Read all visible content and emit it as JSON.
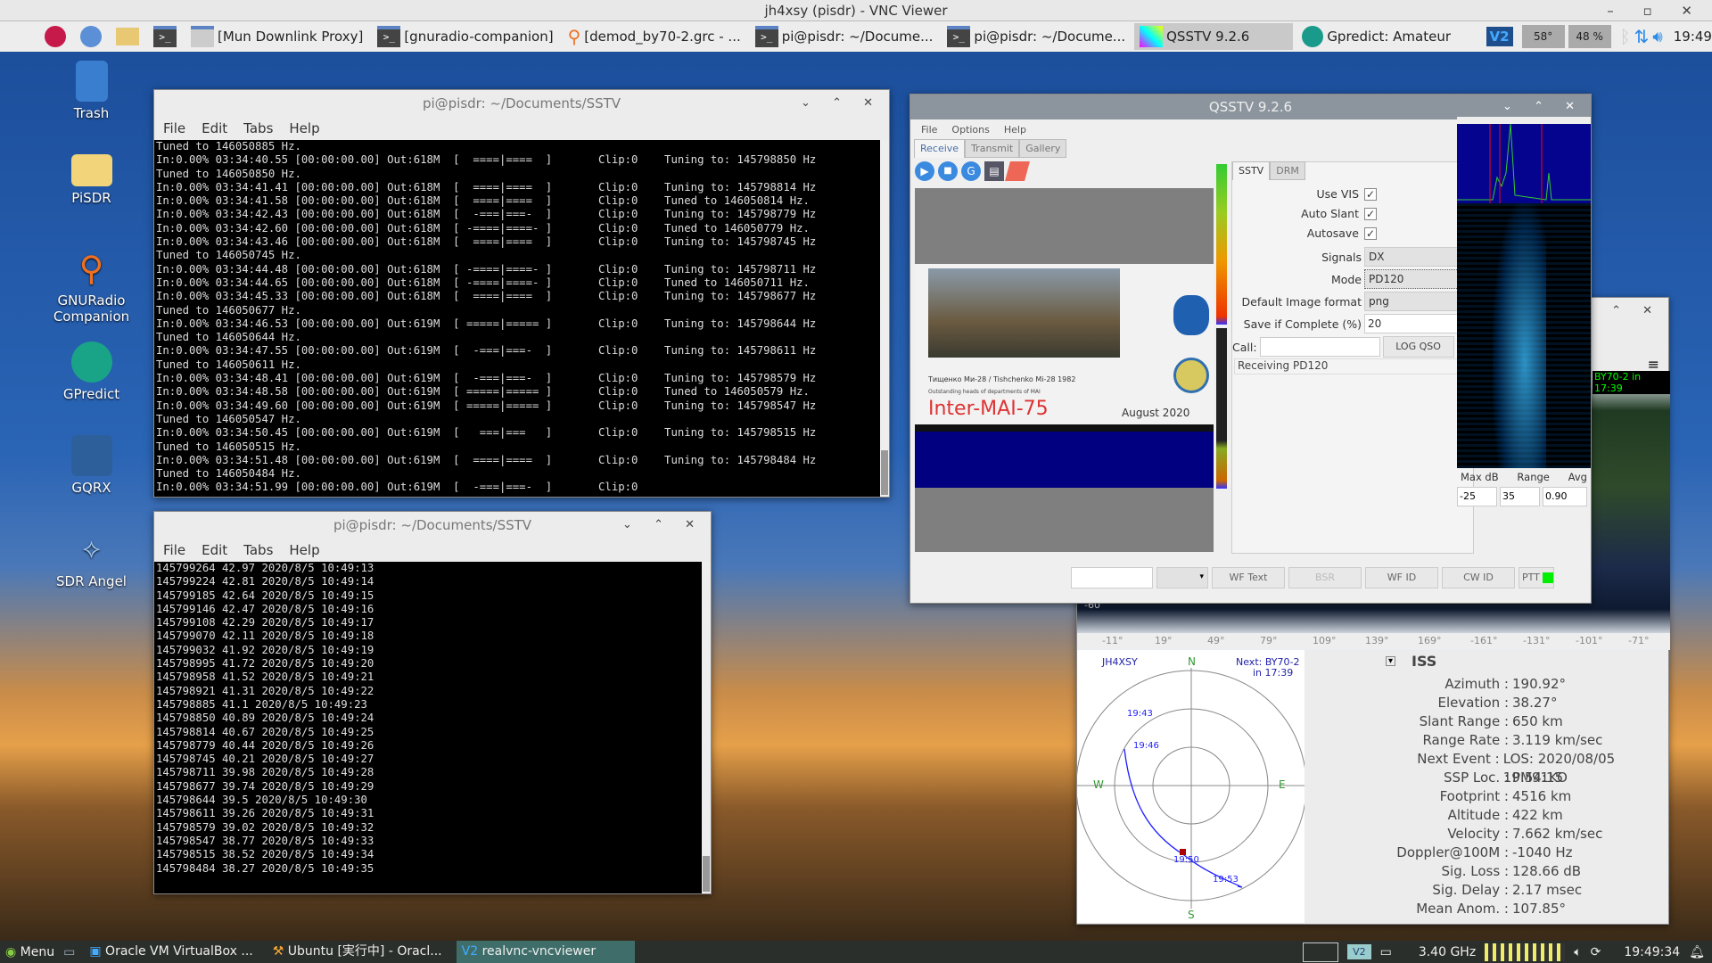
{
  "vnc": {
    "title": "jh4xsy (pisdr) - VNC Viewer",
    "controls": "– ▫ ✕"
  },
  "top_panel": {
    "items": [
      {
        "label": "",
        "icon": "raspberry-icon"
      },
      {
        "label": "",
        "icon": "globe-icon"
      },
      {
        "label": "",
        "icon": "folder-icon"
      },
      {
        "label": "",
        "icon": "terminal-icon"
      },
      {
        "label": "[Mun Downlink Proxy]",
        "icon": "window-icon"
      },
      {
        "label": "[gnuradio-companion]",
        "icon": "terminal-icon"
      },
      {
        "label": "[demod_by70-2.grc - ...",
        "icon": "gnuradio-icon"
      },
      {
        "label": "pi@pisdr: ~/Docume...",
        "icon": "terminal-icon"
      },
      {
        "label": "pi@pisdr: ~/Docume...",
        "icon": "terminal-icon"
      },
      {
        "label": "QSSTV 9.2.6",
        "icon": "qsstv-icon"
      },
      {
        "label": "Gpredict: Amateur",
        "icon": "gpredict-icon"
      }
    ],
    "cpu_temp": "58°",
    "cpu_usage": "48 %",
    "clock": "19:49"
  },
  "desktop_icons": [
    {
      "label": "Trash"
    },
    {
      "label": "PiSDR"
    },
    {
      "label": "GNURadio Companion"
    },
    {
      "label": "GPredict"
    },
    {
      "label": "GQRX"
    },
    {
      "label": "SDR Angel"
    }
  ],
  "terminal1": {
    "title": "pi@pisdr: ~/Documents/SSTV",
    "menu": [
      "File",
      "Edit",
      "Tabs",
      "Help"
    ],
    "lines": [
      "Tuned to 146050885 Hz.",
      "In:0.00% 03:34:40.55 [00:00:00.00] Out:618M  [  ====|====  ]       Clip:0    Tuning to: 145798850 Hz",
      "Tuned to 146050850 Hz.",
      "In:0.00% 03:34:41.41 [00:00:00.00] Out:618M  [  ====|====  ]       Clip:0    Tuning to: 145798814 Hz",
      "In:0.00% 03:34:41.58 [00:00:00.00] Out:618M  [  ====|====  ]       Clip:0    Tuned to 146050814 Hz.",
      "In:0.00% 03:34:42.43 [00:00:00.00] Out:618M  [  -===|===-  ]       Clip:0    Tuning to: 145798779 Hz",
      "In:0.00% 03:34:42.60 [00:00:00.00] Out:618M  [ -====|====- ]       Clip:0    Tuned to 146050779 Hz.",
      "In:0.00% 03:34:43.46 [00:00:00.00] Out:618M  [  ====|====  ]       Clip:0    Tuning to: 145798745 Hz",
      "Tuned to 146050745 Hz.",
      "In:0.00% 03:34:44.48 [00:00:00.00] Out:618M  [ -====|====- ]       Clip:0    Tuning to: 145798711 Hz",
      "In:0.00% 03:34:44.65 [00:00:00.00] Out:618M  [ -====|====- ]       Clip:0    Tuned to 146050711 Hz.",
      "In:0.00% 03:34:45.33 [00:00:00.00] Out:618M  [  ====|====  ]       Clip:0    Tuning to: 145798677 Hz",
      "Tuned to 146050677 Hz.",
      "In:0.00% 03:34:46.53 [00:00:00.00] Out:619M  [ =====|===== ]       Clip:0    Tuning to: 145798644 Hz",
      "Tuned to 146050644 Hz.",
      "In:0.00% 03:34:47.55 [00:00:00.00] Out:619M  [  -===|===-  ]       Clip:0    Tuning to: 145798611 Hz",
      "Tuned to 146050611 Hz.",
      "In:0.00% 03:34:48.41 [00:00:00.00] Out:619M  [  -===|===-  ]       Clip:0    Tuning to: 145798579 Hz",
      "In:0.00% 03:34:48.58 [00:00:00.00] Out:619M  [ =====|===== ]       Clip:0    Tuned to 146050579 Hz.",
      "In:0.00% 03:34:49.60 [00:00:00.00] Out:619M  [ =====|===== ]       Clip:0    Tuning to: 145798547 Hz",
      "Tuned to 146050547 Hz.",
      "In:0.00% 03:34:50.45 [00:00:00.00] Out:619M  [   ===|===   ]       Clip:0    Tuning to: 145798515 Hz",
      "Tuned to 146050515 Hz.",
      "In:0.00% 03:34:51.48 [00:00:00.00] Out:619M  [  ====|====  ]       Clip:0    Tuning to: 145798484 Hz",
      "Tuned to 146050484 Hz.",
      "In:0.00% 03:34:51.99 [00:00:00.00] Out:619M  [  -===|===-  ]       Clip:0    "
    ]
  },
  "terminal2": {
    "title": "pi@pisdr: ~/Documents/SSTV",
    "menu": [
      "File",
      "Edit",
      "Tabs",
      "Help"
    ],
    "lines": [
      "145799264 42.97 2020/8/5 10:49:13",
      "145799224 42.81 2020/8/5 10:49:14",
      "145799185 42.64 2020/8/5 10:49:15",
      "145799146 42.47 2020/8/5 10:49:16",
      "145799108 42.29 2020/8/5 10:49:17",
      "145799070 42.11 2020/8/5 10:49:18",
      "145799032 41.92 2020/8/5 10:49:19",
      "145798995 41.72 2020/8/5 10:49:20",
      "145798958 41.52 2020/8/5 10:49:21",
      "145798921 41.31 2020/8/5 10:49:22",
      "145798885 41.1 2020/8/5 10:49:23",
      "145798850 40.89 2020/8/5 10:49:24",
      "145798814 40.67 2020/8/5 10:49:25",
      "145798779 40.44 2020/8/5 10:49:26",
      "145798745 40.21 2020/8/5 10:49:27",
      "145798711 39.98 2020/8/5 10:49:28",
      "145798677 39.74 2020/8/5 10:49:29",
      "145798644 39.5 2020/8/5 10:49:30",
      "145798611 39.26 2020/8/5 10:49:31",
      "145798579 39.02 2020/8/5 10:49:32",
      "145798547 38.77 2020/8/5 10:49:33",
      "145798515 38.52 2020/8/5 10:49:34",
      "145798484 38.27 2020/8/5 10:49:35"
    ]
  },
  "qsstv": {
    "title": "QSSTV 9.2.6",
    "menu": [
      "File",
      "Options",
      "Help"
    ],
    "tabs": [
      "Receive",
      "Transmit",
      "Gallery"
    ],
    "subtabs": [
      "SSTV",
      "DRM"
    ],
    "use_vis": {
      "label": "Use VIS",
      "checked": true
    },
    "auto_slant": {
      "label": "Auto Slant",
      "checked": true
    },
    "autosave": {
      "label": "Autosave",
      "checked": true
    },
    "signals": {
      "label": "Signals",
      "value": "DX"
    },
    "mode": {
      "label": "Mode",
      "value": "PD120"
    },
    "image_format": {
      "label": "Default Image format",
      "value": "png"
    },
    "save_if_complete": {
      "label": "Save if Complete (%)",
      "value": "20"
    },
    "call": {
      "label": "Call:",
      "value": ""
    },
    "log_qso": "LOG QSO",
    "status": "Receiving PD120",
    "image_caption": {
      "line1": "Тищенко Ми-28 / Tishchenko Mi-28 1982",
      "line2": "Outstanding heads of departments of MAI",
      "title": "Inter-MAI-75",
      "date": "August 2020"
    },
    "wf_labels": {
      "maxdb": "Max dB",
      "range": "Range",
      "avg": "Avg"
    },
    "wf_values": {
      "maxdb": "-25",
      "range": "35",
      "avg": "0.90"
    },
    "buttons": [
      "WF Text",
      "BSR",
      "WF ID",
      "CW ID"
    ],
    "ptt": "PTT"
  },
  "gpredict": {
    "map_label": "BY70-2 in 17:39",
    "lat_label": "-60°",
    "lon_ticks": [
      "-11°",
      "19°",
      "49°",
      "79°",
      "109°",
      "139°",
      "169°",
      "-161°",
      "-131°",
      "-101°",
      "-71°"
    ],
    "polar": {
      "station": "JH4XSY",
      "next": "Next: BY70-2",
      "next_in": "in 17:39",
      "N": "N",
      "S": "S",
      "E": "E",
      "W": "W",
      "times": [
        "19:43",
        "19:46",
        "19:50",
        "19:53"
      ]
    },
    "sat": "ISS",
    "info": [
      {
        "k": "Azimuth :",
        "v": "190.92°"
      },
      {
        "k": "Elevation :",
        "v": "38.27°"
      },
      {
        "k": "Slant Range :",
        "v": "650 km"
      },
      {
        "k": "Range Rate :",
        "v": "3.119 km/sec"
      },
      {
        "k": "Next Event :",
        "v": "LOS: 2020/08/05 19:54:15"
      },
      {
        "k": "SSP Loc. :",
        "v": "PM91KO"
      },
      {
        "k": "Footprint :",
        "v": "4516 km"
      },
      {
        "k": "Altitude :",
        "v": "422 km"
      },
      {
        "k": "Velocity :",
        "v": "7.662 km/sec"
      },
      {
        "k": "Doppler@100M :",
        "v": "-1040 Hz"
      },
      {
        "k": "Sig. Loss :",
        "v": "128.66 dB"
      },
      {
        "k": "Sig. Delay :",
        "v": "2.17 msec"
      },
      {
        "k": "Mean Anom. :",
        "v": "107.85°"
      }
    ]
  },
  "bottom_panel": {
    "menu": "Menu",
    "tasks": [
      "Oracle VM VirtualBox ...",
      "Ubuntu [実行中] - Oracl...",
      "realvnc-vncviewer"
    ],
    "cpu_freq": "3.40 GHz",
    "clock": "19:49:34"
  }
}
